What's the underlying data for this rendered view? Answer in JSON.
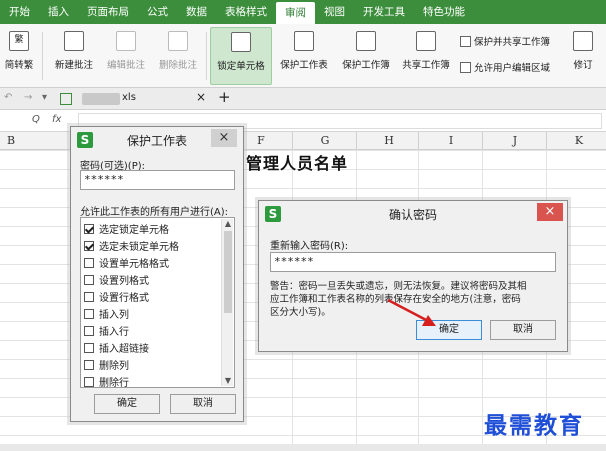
{
  "menu": {
    "tabs": [
      "开始",
      "插入",
      "页面布局",
      "公式",
      "数据",
      "表格样式",
      "审阅",
      "视图",
      "开发工具",
      "特色功能"
    ],
    "active": 6
  },
  "ribbon": {
    "simplify": "简转繁",
    "simplify_sub": "繁",
    "new_comment": "新建批注",
    "edit_comment": "编辑批注",
    "delete_comment": "删除批注",
    "lock_cell": "锁定单元格",
    "protect_sheet": "保护工作表",
    "protect_book": "保护工作簿",
    "share_book": "共享工作簿",
    "protect_share": "保护并共享工作簿",
    "allow_edit": "允许用户编辑区域",
    "revise": "修订"
  },
  "doctab": {
    "filename": "xls"
  },
  "formula": {
    "icons": [
      "Q",
      "fx"
    ]
  },
  "columns": [
    "B",
    "",
    "",
    "F",
    "G",
    "H",
    "I",
    "J",
    "K"
  ],
  "sheet": {
    "title": "管理人员名单"
  },
  "protect_dialog": {
    "title": "保护工作表",
    "password_label": "密码(可选)(P):",
    "password_value": "******",
    "allow_label": "允许此工作表的所有用户进行(A):",
    "items": [
      {
        "label": "选定锁定单元格",
        "checked": true
      },
      {
        "label": "选定未锁定单元格",
        "checked": true
      },
      {
        "label": "设置单元格格式",
        "checked": false
      },
      {
        "label": "设置列格式",
        "checked": false
      },
      {
        "label": "设置行格式",
        "checked": false
      },
      {
        "label": "插入列",
        "checked": false
      },
      {
        "label": "插入行",
        "checked": false
      },
      {
        "label": "插入超链接",
        "checked": false
      },
      {
        "label": "删除列",
        "checked": false
      },
      {
        "label": "删除行",
        "checked": false
      }
    ],
    "ok": "确定",
    "cancel": "取消"
  },
  "confirm_dialog": {
    "title": "确认密码",
    "reenter_label": "重新输入密码(R):",
    "password_value": "******",
    "warning_lines": [
      "警告：密码一旦丢失或遗忘，则无法恢复。建议将密码及其相",
      "应工作簿和工作表名称的列表保存在安全的地方(注意，密码",
      "区分大小写)。"
    ],
    "ok": "确定",
    "cancel": "取消"
  },
  "watermark": "最需教育",
  "colors": {
    "accent": "#3c8e3c",
    "close_red": "#d9534f",
    "watermark": "#1f4fd6"
  }
}
